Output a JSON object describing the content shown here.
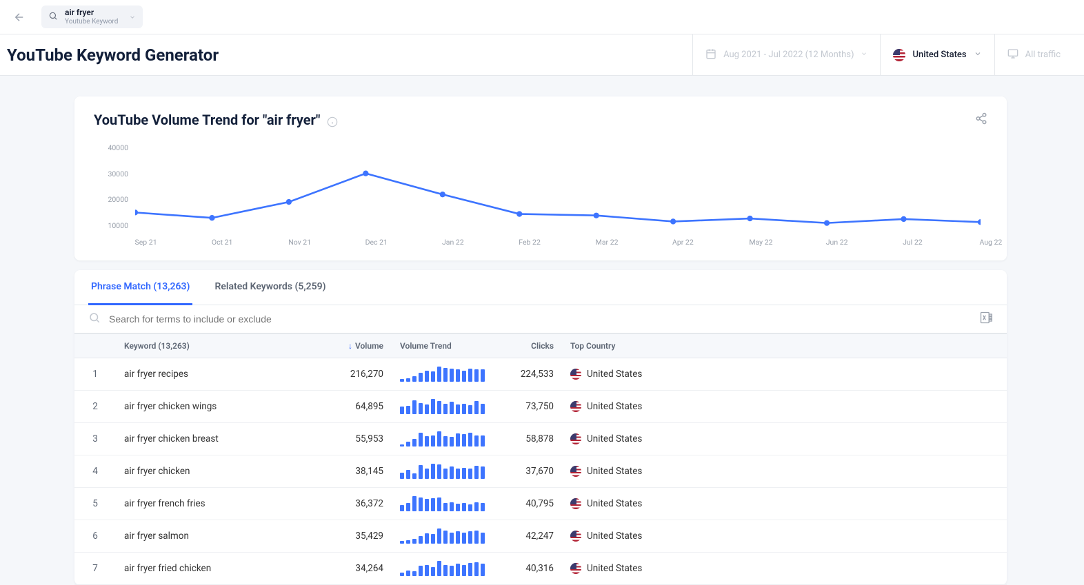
{
  "topbar": {
    "search_term": "air fryer",
    "search_subtitle": "Youtube Keyword"
  },
  "header": {
    "page_title": "YouTube Keyword Generator",
    "date_range": "Aug 2021 - Jul 2022 (12 Months)",
    "country": "United States",
    "traffic": "All traffic"
  },
  "chart": {
    "title": "YouTube Volume Trend for \"air fryer\""
  },
  "chart_data": {
    "type": "line",
    "categories": [
      "Sep 21",
      "Oct 21",
      "Nov 21",
      "Dec 21",
      "Jan 22",
      "Feb 22",
      "Mar 22",
      "Apr 22",
      "May 22",
      "Jun 22",
      "Jul 22",
      "Aug 22"
    ],
    "values": [
      17000,
      15200,
      20500,
      30000,
      23000,
      16500,
      16000,
      14000,
      15000,
      13500,
      14800,
      13800
    ],
    "ylabel": "",
    "y_ticks": [
      40000,
      30000,
      20000,
      10000
    ],
    "ylim": [
      10000,
      40000
    ]
  },
  "tabs": {
    "phrase_match": "Phrase Match (13,263)",
    "related": "Related Keywords (5,259)"
  },
  "filter": {
    "placeholder": "Search for terms to include or exclude"
  },
  "table": {
    "headers": {
      "keyword": "Keyword (13,263)",
      "volume": "Volume",
      "volume_trend": "Volume Trend",
      "clicks": "Clicks",
      "top_country": "Top Country"
    },
    "rows": [
      {
        "idx": "1",
        "keyword": "air fryer recipes",
        "volume": "216,270",
        "clicks": "224,533",
        "country": "United States",
        "spark": [
          4,
          5,
          7,
          12,
          15,
          14,
          20,
          18,
          17,
          16,
          15,
          17,
          16,
          16
        ]
      },
      {
        "idx": "2",
        "keyword": "air fryer chicken wings",
        "volume": "64,895",
        "clicks": "73,750",
        "country": "United States",
        "spark": [
          10,
          11,
          18,
          15,
          13,
          20,
          17,
          14,
          16,
          13,
          14,
          12,
          17,
          14
        ]
      },
      {
        "idx": "3",
        "keyword": "air fryer chicken breast",
        "volume": "55,953",
        "clicks": "58,878",
        "country": "United States",
        "spark": [
          3,
          6,
          10,
          18,
          14,
          15,
          20,
          14,
          13,
          17,
          16,
          18,
          15,
          15
        ]
      },
      {
        "idx": "4",
        "keyword": "air fryer chicken",
        "volume": "38,145",
        "clicks": "37,670",
        "country": "United States",
        "spark": [
          8,
          12,
          7,
          18,
          14,
          20,
          19,
          14,
          16,
          14,
          15,
          14,
          17,
          16
        ]
      },
      {
        "idx": "5",
        "keyword": "air fryer french fries",
        "volume": "36,372",
        "clicks": "40,795",
        "country": "United States",
        "spark": [
          8,
          11,
          20,
          18,
          16,
          17,
          18,
          11,
          12,
          10,
          11,
          9,
          12,
          11
        ]
      },
      {
        "idx": "6",
        "keyword": "air fryer salmon",
        "volume": "35,429",
        "clicks": "42,247",
        "country": "United States",
        "spark": [
          4,
          5,
          6,
          10,
          14,
          13,
          20,
          17,
          15,
          16,
          15,
          16,
          17,
          15
        ]
      },
      {
        "idx": "7",
        "keyword": "air fryer fried chicken",
        "volume": "34,264",
        "clicks": "40,316",
        "country": "United States",
        "spark": [
          5,
          7,
          6,
          14,
          15,
          12,
          20,
          15,
          14,
          16,
          15,
          17,
          18,
          16
        ]
      }
    ]
  }
}
